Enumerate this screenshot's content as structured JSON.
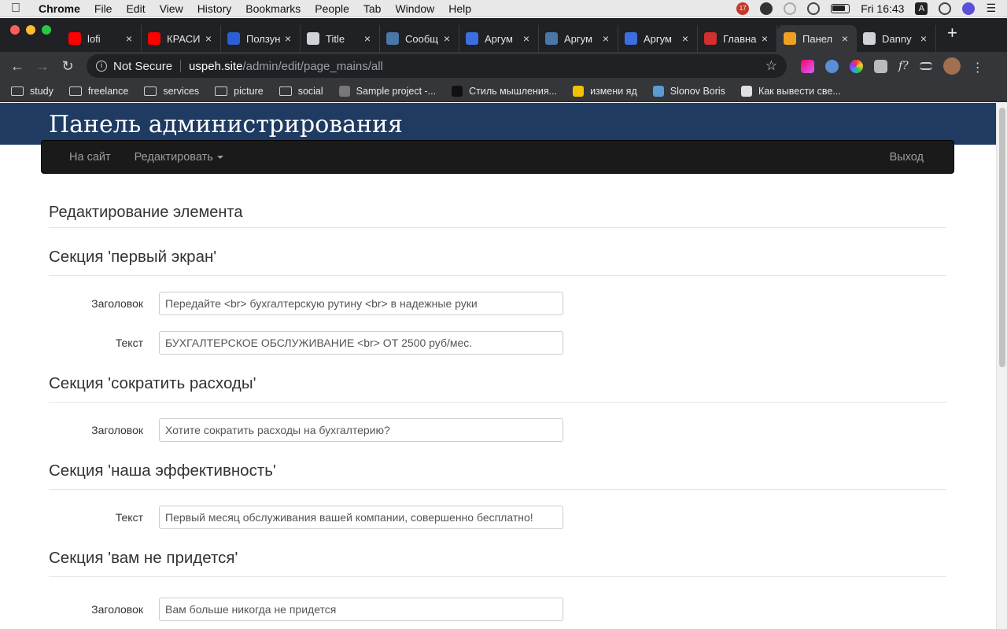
{
  "menubar": {
    "app": "Chrome",
    "items": [
      "File",
      "Edit",
      "View",
      "History",
      "Bookmarks",
      "People",
      "Tab",
      "Window",
      "Help"
    ],
    "clock": "Fri 16:43",
    "input_source": "A",
    "notification_count": "17"
  },
  "tabs": [
    {
      "label": "lofi",
      "color": "#ff0000",
      "active": false
    },
    {
      "label": "КРАСИ",
      "color": "#ff0000",
      "active": false
    },
    {
      "label": "Ползун",
      "color": "#2c5fd6",
      "active": false
    },
    {
      "label": "Title",
      "color": "#cfd3d8",
      "active": false
    },
    {
      "label": "Сообщ",
      "color": "#4a76a8",
      "active": false
    },
    {
      "label": "Аргум",
      "color": "#3b6ee0",
      "active": false
    },
    {
      "label": "Аргум",
      "color": "#4a76a8",
      "active": false
    },
    {
      "label": "Аргум",
      "color": "#3b6ee0",
      "active": false
    },
    {
      "label": "Главна",
      "color": "#d22f2f",
      "active": false
    },
    {
      "label": "Панел",
      "color": "#f0a020",
      "active": true
    },
    {
      "label": "Danny",
      "color": "#cfd3d8",
      "active": false
    }
  ],
  "toolbar": {
    "security": "Not Secure",
    "host": "uspeh.site",
    "path": "/admin/edit/page_mains/all"
  },
  "bookmarks": [
    {
      "label": "study",
      "type": "folder"
    },
    {
      "label": "freelance",
      "type": "folder"
    },
    {
      "label": "services",
      "type": "folder"
    },
    {
      "label": "picture",
      "type": "folder"
    },
    {
      "label": "social",
      "type": "folder"
    },
    {
      "label": "Sample project -...",
      "type": "link",
      "color": "#777777"
    },
    {
      "label": "Стиль мышления...",
      "type": "link",
      "color": "#111111"
    },
    {
      "label": "измени яд",
      "type": "link",
      "color": "#f2c200"
    },
    {
      "label": "Slonov Boris",
      "type": "link",
      "color": "#5b9bd5"
    },
    {
      "label": "Как вывести све...",
      "type": "link",
      "color": "#e0e0e0"
    }
  ],
  "admin": {
    "title": "Панель администрирования",
    "nav_site": "На сайт",
    "nav_edit": "Редактировать",
    "nav_logout": "Выход"
  },
  "content": {
    "heading": "Редактирование элемента",
    "sections": [
      {
        "title": "Секция 'первый экран'",
        "fields": [
          {
            "label": "Заголовок",
            "value": "Передайте <br> бухгалтерскую рутину <br> в надежные руки"
          },
          {
            "label": "Текст",
            "value": "БУХГАЛТЕРСКОЕ ОБСЛУЖИВАНИЕ <br> ОТ 2500 руб/мес."
          }
        ]
      },
      {
        "title": "Секция 'сократить расходы'",
        "fields": [
          {
            "label": "Заголовок",
            "value": "Хотите сократить расходы на бухгалтерию?"
          }
        ]
      },
      {
        "title": "Секция 'наша эффективность'",
        "fields": [
          {
            "label": "Текст",
            "value": "Первый месяц обслуживания вашей компании, совершенно бесплатно!"
          }
        ]
      },
      {
        "title": "Секция 'вам не придется'",
        "fields": [
          {
            "label": "Заголовок",
            "value": "Вам больше никогда не придется"
          }
        ]
      }
    ]
  }
}
